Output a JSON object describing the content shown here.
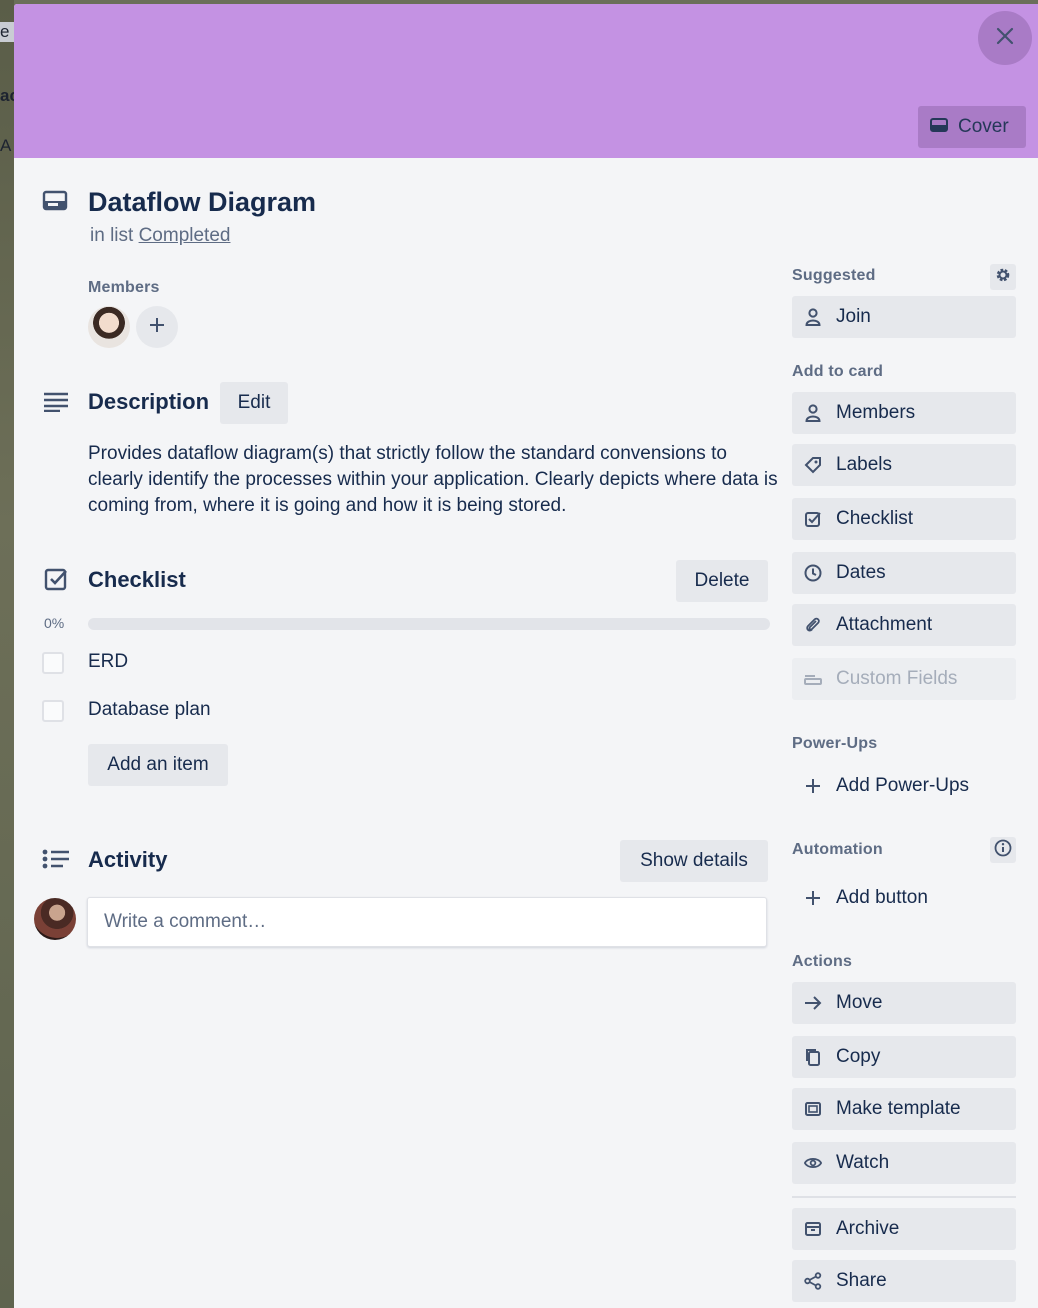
{
  "background": {
    "peek_texts": [
      "e",
      "ac",
      "A"
    ]
  },
  "header": {
    "close_icon": "close-icon",
    "cover_label": "Cover",
    "cover_color": "#c492e3"
  },
  "card": {
    "title": "Dataflow Diagram",
    "in_list_prefix": "in list",
    "list_name": "Completed"
  },
  "members": {
    "label": "Members"
  },
  "description": {
    "title": "Description",
    "edit_label": "Edit",
    "text": "Provides dataflow diagram(s) that strictly follow the standard convensions to clearly identify the processes within your application. Clearly depicts where data is coming from, where it is going and how it is being stored."
  },
  "checklist": {
    "title": "Checklist",
    "delete_label": "Delete",
    "progress_label": "0%",
    "progress": 0,
    "items": [
      {
        "label": "ERD",
        "checked": false
      },
      {
        "label": "Database plan",
        "checked": false
      }
    ],
    "add_item_label": "Add an item"
  },
  "activity": {
    "title": "Activity",
    "show_details_label": "Show details",
    "comment_placeholder": "Write a comment…"
  },
  "sidebar": {
    "suggested_label": "Suggested",
    "join_label": "Join",
    "add_to_card_label": "Add to card",
    "add_to_card": [
      {
        "label": "Members",
        "icon": "person-icon"
      },
      {
        "label": "Labels",
        "icon": "tag-icon"
      },
      {
        "label": "Checklist",
        "icon": "checkbox-icon"
      },
      {
        "label": "Dates",
        "icon": "clock-icon"
      },
      {
        "label": "Attachment",
        "icon": "paperclip-icon"
      },
      {
        "label": "Custom Fields",
        "icon": "custom-fields-icon",
        "disabled": true
      }
    ],
    "powerups_label": "Power-Ups",
    "add_powerups_label": "Add Power-Ups",
    "automation_label": "Automation",
    "add_button_label": "Add button",
    "actions_label": "Actions",
    "actions": [
      {
        "label": "Move",
        "icon": "arrow-right-icon"
      },
      {
        "label": "Copy",
        "icon": "copy-icon"
      },
      {
        "label": "Make template",
        "icon": "template-icon"
      },
      {
        "label": "Watch",
        "icon": "eye-icon"
      },
      {
        "label": "Archive",
        "icon": "archive-icon"
      },
      {
        "label": "Share",
        "icon": "share-icon"
      }
    ]
  }
}
